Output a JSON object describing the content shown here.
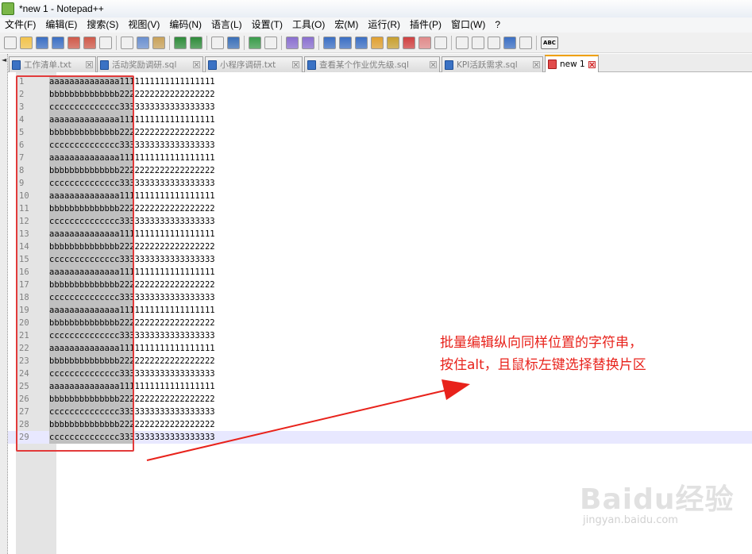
{
  "window": {
    "title": "*new 1 - Notepad++"
  },
  "menu": [
    "文件(F)",
    "编辑(E)",
    "搜索(S)",
    "视图(V)",
    "编码(N)",
    "语言(L)",
    "设置(T)",
    "工具(O)",
    "宏(M)",
    "运行(R)",
    "插件(P)",
    "窗口(W)",
    "?"
  ],
  "toolbar": {
    "buttons": [
      "new-file-icon",
      "open-file-icon",
      "save-icon",
      "save-all-icon",
      "close-icon",
      "close-all-icon",
      "print-icon",
      "cut-icon",
      "copy-icon",
      "paste-icon",
      "undo-icon",
      "redo-icon",
      "find-icon",
      "replace-icon",
      "zoom-in-icon",
      "zoom-out-icon",
      "sync-vertical-icon",
      "sync-horizontal-icon",
      "word-wrap-icon",
      "show-all-chars-icon",
      "indent-guide-icon",
      "user-lang-icon",
      "doc-map-icon",
      "function-list-icon",
      "folder-workspace-icon",
      "monitor-icon",
      "record-macro-icon",
      "stop-record-icon",
      "play-macro-icon",
      "run-macro-multiple-icon",
      "save-macro-icon",
      "spell-check-icon"
    ],
    "spell_label": "ABC"
  },
  "tabs": [
    {
      "label": "工作清单.txt",
      "icon": "saved",
      "active": false
    },
    {
      "label": "活动奖励调研.sql",
      "icon": "saved",
      "active": false
    },
    {
      "label": "小程序调研.txt",
      "icon": "saved",
      "active": false
    },
    {
      "label": "查看某个作业优先级.sql",
      "icon": "saved",
      "active": false
    },
    {
      "label": "KPI活跃需求.sql",
      "icon": "saved",
      "active": false
    },
    {
      "label": "new 1",
      "icon": "unsaved",
      "active": true
    }
  ],
  "editor": {
    "current_line": 29,
    "lines": [
      "aaaaaaaaaaaaaa1111111111111111111",
      "bbbbbbbbbbbbbb2222222222222222222",
      "cccccccccccccc3333333333333333333",
      "aaaaaaaaaaaaaa1111111111111111111",
      "bbbbbbbbbbbbbb2222222222222222222",
      "cccccccccccccc3333333333333333333",
      "aaaaaaaaaaaaaa1111111111111111111",
      "bbbbbbbbbbbbbb2222222222222222222",
      "cccccccccccccc3333333333333333333",
      "aaaaaaaaaaaaaa1111111111111111111",
      "bbbbbbbbbbbbbb2222222222222222222",
      "cccccccccccccc3333333333333333333",
      "aaaaaaaaaaaaaa1111111111111111111",
      "bbbbbbbbbbbbbb2222222222222222222",
      "cccccccccccccc3333333333333333333",
      "aaaaaaaaaaaaaa1111111111111111111",
      "bbbbbbbbbbbbbb2222222222222222222",
      "cccccccccccccc3333333333333333333",
      "aaaaaaaaaaaaaa1111111111111111111",
      "bbbbbbbbbbbbbb2222222222222222222",
      "cccccccccccccc3333333333333333333",
      "aaaaaaaaaaaaaa1111111111111111111",
      "bbbbbbbbbbbbbb2222222222222222222",
      "cccccccccccccc3333333333333333333",
      "aaaaaaaaaaaaaa1111111111111111111",
      "bbbbbbbbbbbbbb2222222222222222222",
      "cccccccccccccc3333333333333333333",
      "bbbbbbbbbbbbbb2222222222222222222",
      "cccccccccccccc3333333333333333333"
    ]
  },
  "annotation": {
    "line1": "批量编辑纵向同样位置的字符串，",
    "line2": "按住alt，且鼠标左键选择替换片区",
    "color": "#e8221b"
  },
  "watermark": {
    "logo": "Baidu经验",
    "url": "jingyan.baidu.com"
  },
  "colors": {
    "selection": "#c0c0c0",
    "current_line": "#e8e8ff",
    "gutter": "#e4e4e4",
    "active_tab_accent": "#f0a000"
  }
}
